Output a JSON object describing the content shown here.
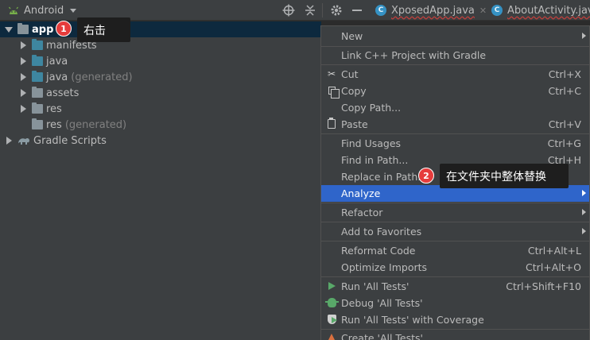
{
  "toolbar": {
    "view_mode": "Android",
    "icons": [
      "android-icon",
      "target-icon",
      "collapse-all-icon",
      "gear-icon",
      "minimize-icon"
    ]
  },
  "tabs": [
    {
      "name": "XposedApp.java",
      "icon": "class-icon",
      "close": "✕"
    },
    {
      "name": "AboutActivity.java",
      "icon": "class-icon",
      "close": ""
    }
  ],
  "tree": {
    "items": [
      {
        "label": "app",
        "sub": "",
        "expanded": true,
        "icon": "module-folder-icon"
      },
      {
        "label": "manifests",
        "sub": "",
        "icon": "folder-icon"
      },
      {
        "label": "java",
        "sub": "",
        "icon": "folder-icon"
      },
      {
        "label": "java",
        "sub": "(generated)",
        "icon": "generated-folder-icon"
      },
      {
        "label": "assets",
        "sub": "",
        "icon": "folder-icon"
      },
      {
        "label": "res",
        "sub": "",
        "icon": "res-folder-icon"
      },
      {
        "label": "res",
        "sub": "(generated)",
        "icon": "res-folder-icon"
      },
      {
        "label": "Gradle Scripts",
        "sub": "",
        "icon": "gradle-icon"
      }
    ]
  },
  "callouts": [
    {
      "number": "1",
      "text": "右击"
    },
    {
      "number": "2",
      "text": "在文件夹中整体替换"
    }
  ],
  "menu": {
    "items": [
      {
        "label": "New",
        "shortcut": "",
        "submenu": true
      },
      {
        "label": "Link C++ Project with Gradle",
        "shortcut": ""
      },
      {
        "label": "Cut",
        "shortcut": "Ctrl+X",
        "icon": "scissors-icon"
      },
      {
        "label": "Copy",
        "shortcut": "Ctrl+C",
        "icon": "copy-icon"
      },
      {
        "label": "Copy Path...",
        "shortcut": ""
      },
      {
        "label": "Paste",
        "shortcut": "Ctrl+V",
        "icon": "paste-icon"
      },
      {
        "label": "Find Usages",
        "shortcut": "Ctrl+G"
      },
      {
        "label": "Find in Path...",
        "shortcut": "Ctrl+H"
      },
      {
        "label": "Replace in Path...",
        "shortcut": ""
      },
      {
        "label": "Analyze",
        "shortcut": "",
        "submenu": true,
        "active": true
      },
      {
        "label": "Refactor",
        "shortcut": "",
        "submenu": true
      },
      {
        "label": "Add to Favorites",
        "shortcut": "",
        "submenu": true
      },
      {
        "label": "Reformat Code",
        "shortcut": "Ctrl+Alt+L"
      },
      {
        "label": "Optimize Imports",
        "shortcut": "Ctrl+Alt+O"
      },
      {
        "label": "Run 'All Tests'",
        "shortcut": "Ctrl+Shift+F10",
        "icon": "run-icon"
      },
      {
        "label": "Debug 'All Tests'",
        "shortcut": "",
        "icon": "debug-icon"
      },
      {
        "label": "Run 'All Tests' with Coverage",
        "shortcut": "",
        "icon": "coverage-icon"
      },
      {
        "label": "Create 'All Tests'...",
        "shortcut": "",
        "icon": "create-test-icon"
      }
    ]
  },
  "colors": {
    "menu_active": "#2f65ca",
    "selection": "#0d293e",
    "badge": "#e63c3c"
  }
}
